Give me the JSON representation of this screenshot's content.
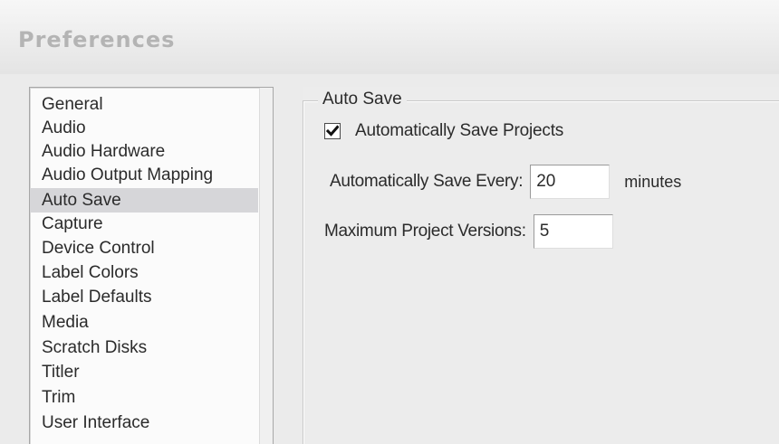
{
  "window": {
    "title": "Preferences"
  },
  "categories": [
    {
      "label": "General",
      "selected": false
    },
    {
      "label": "Audio",
      "selected": false
    },
    {
      "label": "Audio Hardware",
      "selected": false
    },
    {
      "label": "Audio Output Mapping",
      "selected": false
    },
    {
      "label": "Auto Save",
      "selected": true
    },
    {
      "label": "Capture",
      "selected": false
    },
    {
      "label": "Device Control",
      "selected": false
    },
    {
      "label": "Label Colors",
      "selected": false
    },
    {
      "label": "Label Defaults",
      "selected": false
    },
    {
      "label": "Media",
      "selected": false
    },
    {
      "label": "Scratch Disks",
      "selected": false
    },
    {
      "label": "Titler",
      "selected": false
    },
    {
      "label": "Trim",
      "selected": false
    },
    {
      "label": "User Interface",
      "selected": false
    }
  ],
  "auto_save": {
    "group_label": "Auto Save",
    "auto_save_checkbox": {
      "label": "Automatically Save Projects",
      "checked": true
    },
    "interval": {
      "label": "Automatically Save Every:",
      "value": "20",
      "unit": "minutes"
    },
    "versions": {
      "label": "Maximum Project Versions:",
      "value": "5"
    }
  },
  "colors": {
    "selected_row": "#d6d6d9",
    "window_background": "#ebebeb"
  },
  "icons": {
    "checkmark": "check-icon"
  }
}
